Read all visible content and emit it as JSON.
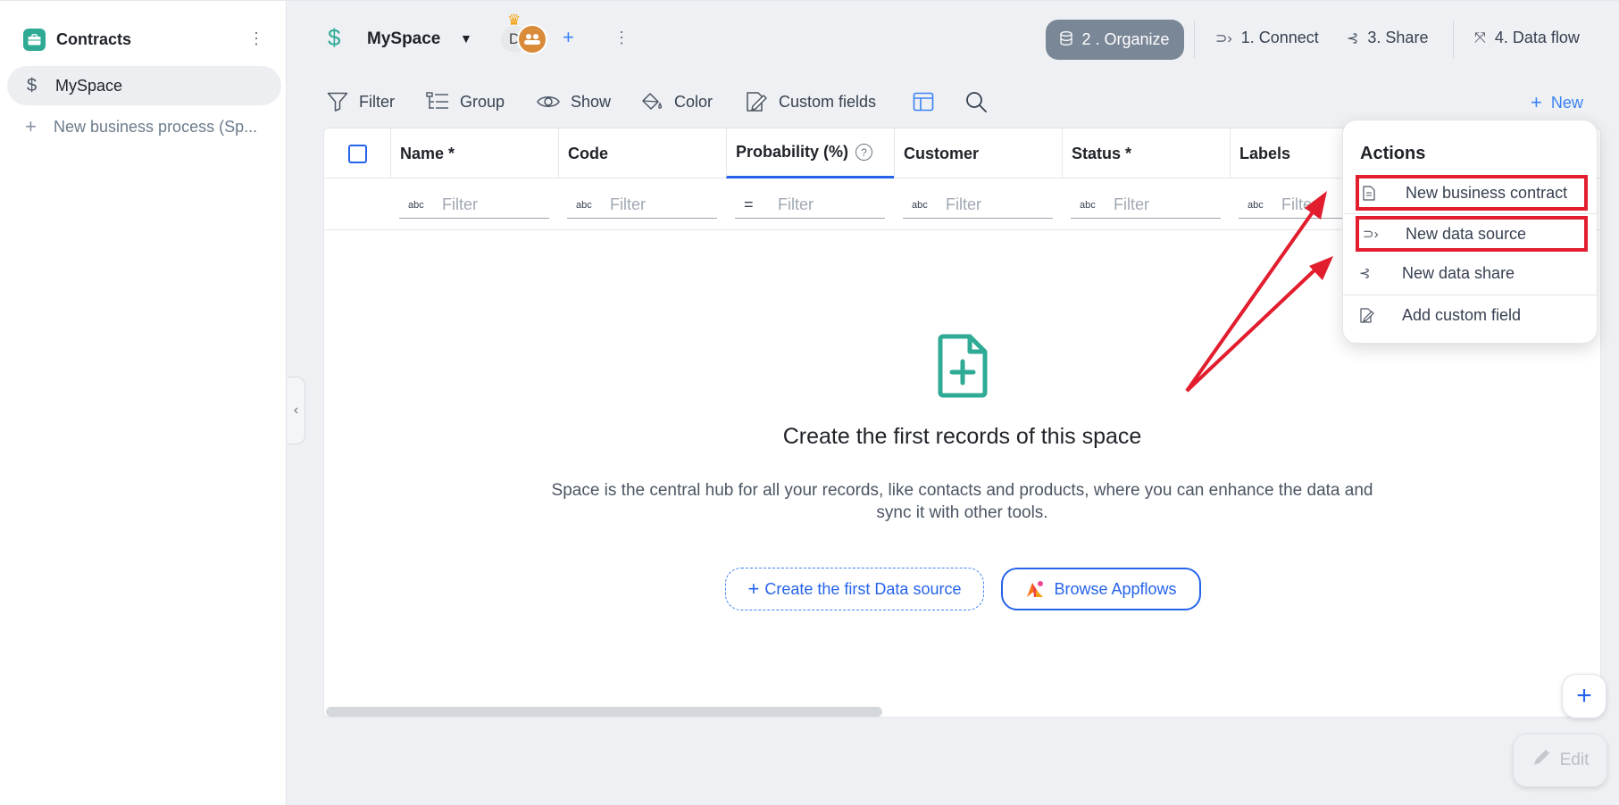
{
  "sidebar": {
    "title": "Contracts",
    "items": [
      {
        "label": "MySpace"
      }
    ],
    "new_process": "New business process (Sp..."
  },
  "topbar": {
    "space_name": "MySpace",
    "avatar_letter": "D",
    "steps": [
      {
        "label": "2 . Organize",
        "active": true
      },
      {
        "label": "1. Connect"
      },
      {
        "label": "3. Share"
      },
      {
        "label": "4. Data flow"
      }
    ]
  },
  "toolbar": {
    "filter": "Filter",
    "group": "Group",
    "show": "Show",
    "color": "Color",
    "custom_fields": "Custom fields",
    "new": "New"
  },
  "table": {
    "columns": [
      {
        "label": "Name *"
      },
      {
        "label": "Code"
      },
      {
        "label": "Probability (%)"
      },
      {
        "label": "Customer"
      },
      {
        "label": "Status *"
      },
      {
        "label": "Labels"
      }
    ],
    "filter_placeholder": "Filter",
    "text_type_icon": "abc"
  },
  "empty_state": {
    "title": "Create the first records of this space",
    "description": "Space is the central hub for all your records, like contacts and products, where you can enhance the data and sync it with other tools.",
    "create_button": "Create the first Data source",
    "browse_button": "Browse Appflows"
  },
  "actions_menu": {
    "title": "Actions",
    "items": [
      {
        "label": "New business contract",
        "icon": "document-icon"
      },
      {
        "label": "New data source",
        "icon": "connect-icon"
      },
      {
        "label": "New data share",
        "icon": "share-icon"
      },
      {
        "label": "Add custom field",
        "icon": "custom-field-icon"
      }
    ]
  },
  "fab": {
    "edit": "Edit"
  },
  "colors": {
    "brand_teal": "#2eaa95",
    "accent_blue": "#2563eb",
    "highlight_red": "#e11d2e",
    "step_active": "#7a8797"
  }
}
